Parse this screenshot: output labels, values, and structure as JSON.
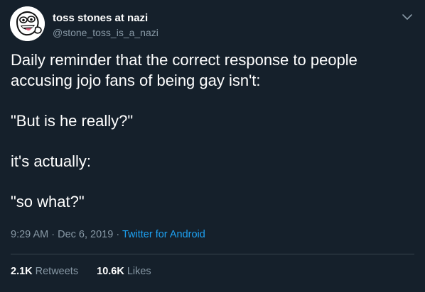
{
  "tweet": {
    "author": {
      "display_name": "toss stones at nazi",
      "handle": "@stone_toss_is_a_nazi",
      "avatar_icon": "meme-face-avatar"
    },
    "menu_icon": "chevron-down-icon",
    "body": {
      "line1": "Daily reminder that the correct response to people",
      "line2": "accusing jojo fans of being gay isn't:",
      "line3": "\"But is he really?\"",
      "line4": "it's actually:",
      "line5": "\"so what?\""
    },
    "meta": {
      "time": "9:29 AM",
      "separator": "·",
      "date": "Dec 6, 2019",
      "source": "Twitter for Android"
    },
    "stats": {
      "retweets_count": "2.1K",
      "retweets_label": "Retweets",
      "likes_count": "10.6K",
      "likes_label": "Likes"
    }
  },
  "colors": {
    "background": "#15202b",
    "text_primary": "#ffffff",
    "text_secondary": "#8899a6",
    "link": "#1da1f2",
    "divider": "#38444d"
  }
}
